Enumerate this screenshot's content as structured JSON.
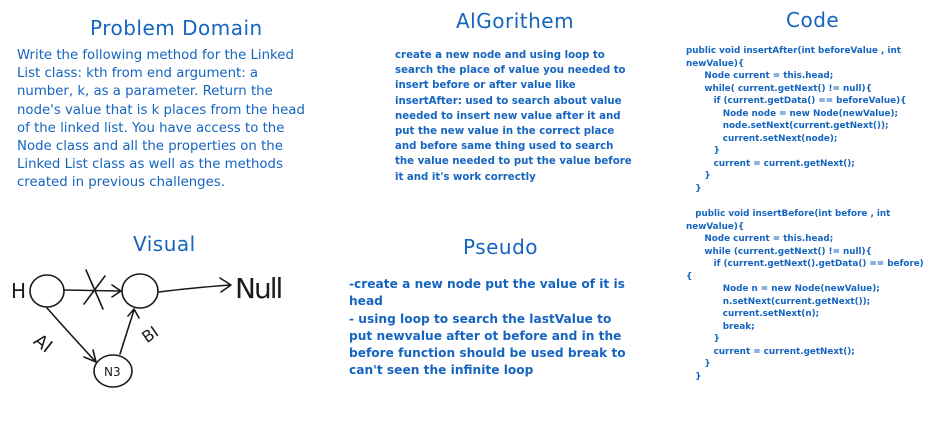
{
  "headings": {
    "problem_domain": "Problem Domain",
    "algorithm": "AlGorithem",
    "code": "Code",
    "visual": "Visual",
    "pseudo": "Pseudo"
  },
  "problem_domain_text": "Write the following method for the Linked List class: kth from end argument: a number, k, as a parameter. Return the node's value that is k places from the head of the linked list. You have access to the Node class and all the properties on the Linked List class as well as the methods created in previous challenges.",
  "algorithm_text": "create a new node and using loop to search the place of value you needed to insert before or after value like insertAfter: used to search about value needed to insert new value after it and put the new value in the correct place and before same thing used to search the value needed to put the value before it and it's work correctly",
  "pseudo_text": "-create a new node put the value of it is head\n- using loop to search the lastValue to put newvalue after ot before and in the before function should be used break to can't seen the infinite loop",
  "code_insert_after": "public void insertAfter(int beforeValue , int\nnewValue){\n      Node current = this.head;\n      while( current.getNext() != null){\n         if (current.getData() == beforeValue){\n            Node node = new Node(newValue);\n            node.setNext(current.getNext());\n            current.setNext(node);\n         }\n         current = current.getNext();\n      }\n   }",
  "code_insert_before": "   public void insertBefore(int before , int\nnewValue){\n      Node current = this.head;\n      while (current.getNext() != null){\n         if (current.getNext().getData() == before)\n{\n            Node n = new Node(newValue);\n            n.setNext(current.getNext());\n            current.setNext(n);\n            break;\n         }\n         current = current.getNext();\n      }\n   }",
  "visual_labels": {
    "head": "H",
    "null": "Null",
    "arrow_a": "AI",
    "arrow_b": "BI",
    "new_node": "N3"
  },
  "colors": {
    "heading": "#1565c0",
    "text": "#1565c0",
    "sketch": "#1a1a1a"
  }
}
